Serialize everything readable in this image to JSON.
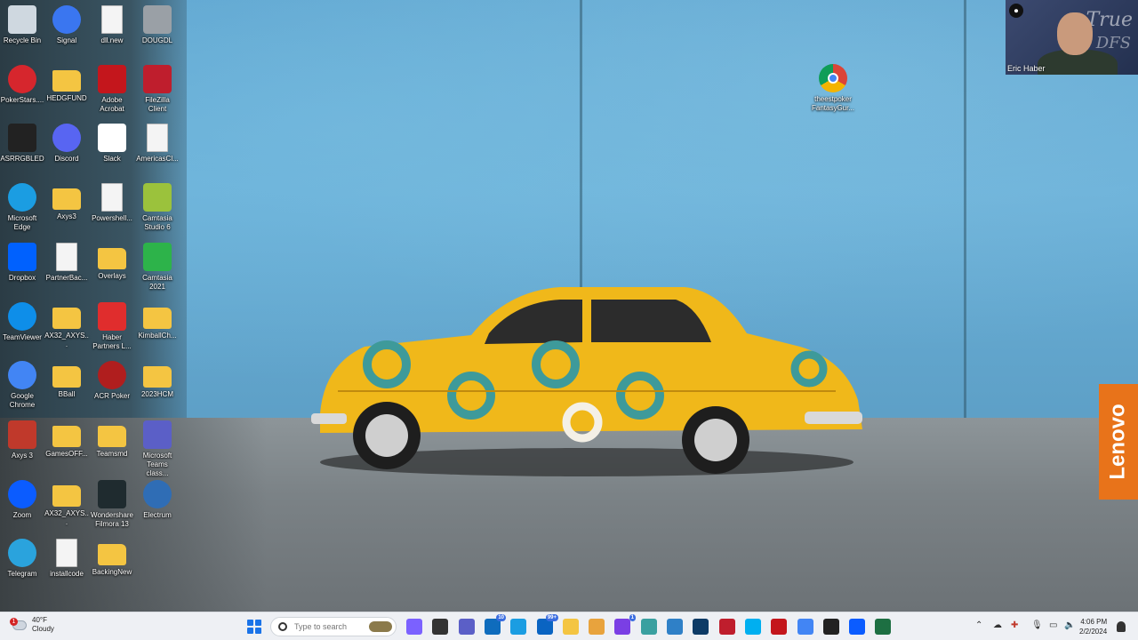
{
  "desktop": {
    "icons": [
      {
        "label": "Recycle Bin",
        "icon": "recycle-bin-icon",
        "color": "#cfd8e0"
      },
      {
        "label": "Signal",
        "icon": "signal-icon",
        "color": "#3a76f0"
      },
      {
        "label": "dll.new",
        "icon": "file-icon",
        "color": "#f4f4f4"
      },
      {
        "label": "DOUGDL",
        "icon": "image-file-icon",
        "color": "#9aa0a6"
      },
      {
        "label": "PokerStars....",
        "icon": "pokerstars-icon",
        "color": "#d6262d"
      },
      {
        "label": "HEDGFUND",
        "icon": "folder-icon",
        "color": "#f4c542"
      },
      {
        "label": "Adobe Acrobat",
        "icon": "adobe-acrobat-icon",
        "color": "#c4161c"
      },
      {
        "label": "FileZilla Client",
        "icon": "filezilla-icon",
        "color": "#bf1e2d"
      },
      {
        "label": "ASRRGBLED",
        "icon": "asrock-rgb-icon",
        "color": "#222222"
      },
      {
        "label": "Discord",
        "icon": "discord-icon",
        "color": "#5865f2"
      },
      {
        "label": "Slack",
        "icon": "slack-icon",
        "color": "#ffffff"
      },
      {
        "label": "AmericasCl...",
        "icon": "file-icon",
        "color": "#f4f4f4"
      },
      {
        "label": "Microsoft Edge",
        "icon": "edge-icon",
        "color": "#1b9de2"
      },
      {
        "label": "Axys3",
        "icon": "folder-icon",
        "color": "#f4c542"
      },
      {
        "label": "Powershell...",
        "icon": "file-icon",
        "color": "#f4f4f4"
      },
      {
        "label": "Camtasia Studio 6",
        "icon": "camtasia-6-icon",
        "color": "#9bc23c"
      },
      {
        "label": "Dropbox",
        "icon": "dropbox-icon",
        "color": "#0061fe"
      },
      {
        "label": "PartnerBac...",
        "icon": "file-icon",
        "color": "#f4f4f4"
      },
      {
        "label": "Overlays",
        "icon": "folder-icon",
        "color": "#f4c542"
      },
      {
        "label": "Camtasia 2021",
        "icon": "camtasia-2021-icon",
        "color": "#2db34a"
      },
      {
        "label": "TeamViewer",
        "icon": "teamviewer-icon",
        "color": "#0e8ee9"
      },
      {
        "label": "AX32_AXYS...",
        "icon": "folder-icon",
        "color": "#f4c542"
      },
      {
        "label": "Haber Partners L...",
        "icon": "pdf-icon",
        "color": "#e02d2d"
      },
      {
        "label": "KimballCh...",
        "icon": "folder-icon",
        "color": "#f4c542"
      },
      {
        "label": "Google Chrome",
        "icon": "chrome-icon",
        "color": "#4285f4"
      },
      {
        "label": "BBall",
        "icon": "folder-icon",
        "color": "#f4c542"
      },
      {
        "label": "ACR Poker",
        "icon": "acr-poker-icon",
        "color": "#b01e1e"
      },
      {
        "label": "2023HCM",
        "icon": "folder-icon",
        "color": "#f4c542"
      },
      {
        "label": "Axys 3",
        "icon": "axys-icon",
        "color": "#c0392b"
      },
      {
        "label": "GamesOFF...",
        "icon": "folder-icon",
        "color": "#f4c542"
      },
      {
        "label": "Teamsmd",
        "icon": "folder-icon",
        "color": "#f4c542"
      },
      {
        "label": "Microsoft Teams class...",
        "icon": "teams-icon",
        "color": "#5b5fc7"
      },
      {
        "label": "Zoom",
        "icon": "zoom-icon",
        "color": "#0b5cff"
      },
      {
        "label": "AX32_AXYS...",
        "icon": "folder-icon",
        "color": "#f4c542"
      },
      {
        "label": "Wondershare Filmora 13",
        "icon": "filmora-icon",
        "color": "#1f2b2f"
      },
      {
        "label": "Electrum",
        "icon": "electrum-icon",
        "color": "#2f6db5"
      },
      {
        "label": "Telegram",
        "icon": "telegram-icon",
        "color": "#2aa3dd"
      },
      {
        "label": "installcode",
        "icon": "file-icon",
        "color": "#f4f4f4"
      },
      {
        "label": "BackingNew",
        "icon": "folder-icon",
        "color": "#f4c542"
      }
    ],
    "right_icon": {
      "label": "theestpoker FantasyGur...",
      "icon": "chrome-icon",
      "color": "#4285f4"
    }
  },
  "webcam": {
    "name": "Eric Haber",
    "brand_line1": "True",
    "brand_line2": "DFS"
  },
  "lenovo": {
    "text": "Lenovo",
    "color": "#e8731a"
  },
  "taskbar": {
    "weather_temp": "40°F",
    "weather_desc": "Cloudy",
    "weather_alert": "1",
    "search_placeholder": "Type to search",
    "apps": [
      {
        "name": "widgets",
        "icon": "widgets-icon",
        "color": "#7b61ff"
      },
      {
        "name": "task-view",
        "icon": "task-view-icon",
        "color": "#333333"
      },
      {
        "name": "chat",
        "icon": "chat-icon",
        "color": "#5b5fc7"
      },
      {
        "name": "outlook",
        "icon": "outlook-icon",
        "color": "#0f6cbd",
        "badge": "10"
      },
      {
        "name": "edge",
        "icon": "edge-icon",
        "color": "#1b9de2"
      },
      {
        "name": "mail",
        "icon": "mail-icon",
        "color": "#0a64c2",
        "badge": "99+"
      },
      {
        "name": "file-explorer",
        "icon": "folder-icon",
        "color": "#f4c542"
      },
      {
        "name": "snipping",
        "icon": "snipping-tool-icon",
        "color": "#e8a33d"
      },
      {
        "name": "messenger",
        "icon": "messenger-icon",
        "color": "#7a3fe4",
        "badge": "1"
      },
      {
        "name": "tool",
        "icon": "tool-icon",
        "color": "#3aa0a0"
      },
      {
        "name": "notepad",
        "icon": "notepad-icon",
        "color": "#2f80c7"
      },
      {
        "name": "teamviewer",
        "icon": "teamviewer-icon",
        "color": "#0e3b66"
      },
      {
        "name": "filezilla",
        "icon": "filezilla-icon",
        "color": "#bf1e2d"
      },
      {
        "name": "skype",
        "icon": "skype-icon",
        "color": "#00aff0"
      },
      {
        "name": "acrobat",
        "icon": "adobe-acrobat-icon",
        "color": "#c4161c"
      },
      {
        "name": "chrome",
        "icon": "chrome-icon",
        "color": "#4285f4"
      },
      {
        "name": "media",
        "icon": "media-player-icon",
        "color": "#222222"
      },
      {
        "name": "zoom",
        "icon": "zoom-icon",
        "color": "#0b5cff"
      },
      {
        "name": "excel",
        "icon": "excel-icon",
        "color": "#1d6f42"
      }
    ],
    "clock_time": "4:06 PM",
    "clock_date": "2/2/2024"
  }
}
